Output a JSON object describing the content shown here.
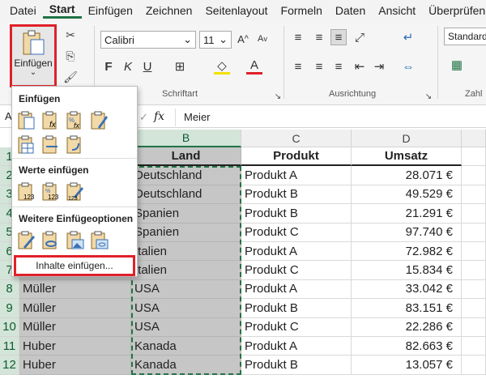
{
  "menu": {
    "tabs": [
      "Datei",
      "Start",
      "Einfügen",
      "Zeichnen",
      "Seitenlayout",
      "Formeln",
      "Daten",
      "Ansicht",
      "Überprüfen"
    ],
    "active": "Start"
  },
  "ribbon": {
    "paste_label": "Einfügen",
    "font_name": "Calibri",
    "font_size": "11",
    "font_group_label": "Schriftart",
    "align_group_label": "Ausrichtung",
    "number_group_label": "Zahl",
    "number_format": "Standard"
  },
  "formula_bar": {
    "cell_ref": "A",
    "fx": "fx",
    "value": "Meier"
  },
  "paste_menu": {
    "section1": "Einfügen",
    "section2": "Werte einfügen",
    "section3": "Weitere Einfügeoptionen",
    "special": "Inhalte einfügen..."
  },
  "columns": [
    "B",
    "C",
    "D"
  ],
  "headers": {
    "b": "Land",
    "c": "Produkt",
    "d": "Umsatz"
  },
  "rows": [
    {
      "n": "1",
      "a": "",
      "b": "Land",
      "c": "Produkt",
      "d": "Umsatz"
    },
    {
      "n": "2",
      "a": "",
      "b": "Deutschland",
      "c": "Produkt A",
      "d": "28.071 €"
    },
    {
      "n": "3",
      "a": "",
      "b": "Deutschland",
      "c": "Produkt B",
      "d": "49.529 €"
    },
    {
      "n": "4",
      "a": "",
      "b": "Spanien",
      "c": "Produkt B",
      "d": "21.291 €"
    },
    {
      "n": "5",
      "a": "",
      "b": "Spanien",
      "c": "Produkt C",
      "d": "97.740 €"
    },
    {
      "n": "6",
      "a": "",
      "b": "Italien",
      "c": "Produkt A",
      "d": "72.982 €"
    },
    {
      "n": "7",
      "a": "",
      "b": "Italien",
      "c": "Produkt C",
      "d": "15.834 €"
    },
    {
      "n": "8",
      "a": "Müller",
      "b": "USA",
      "c": "Produkt A",
      "d": "33.042 €"
    },
    {
      "n": "9",
      "a": "Müller",
      "b": "USA",
      "c": "Produkt B",
      "d": "83.151 €"
    },
    {
      "n": "10",
      "a": "Müller",
      "b": "USA",
      "c": "Produkt C",
      "d": "22.286 €"
    },
    {
      "n": "11",
      "a": "Huber",
      "b": "Kanada",
      "c": "Produkt A",
      "d": "82.663 €"
    },
    {
      "n": "12",
      "a": "Huber",
      "b": "Kanada",
      "c": "Produkt B",
      "d": "13.057 €"
    }
  ],
  "colors": {
    "accent": "#217346",
    "highlight": "#e0202a",
    "selection": "#c6c6c6"
  }
}
